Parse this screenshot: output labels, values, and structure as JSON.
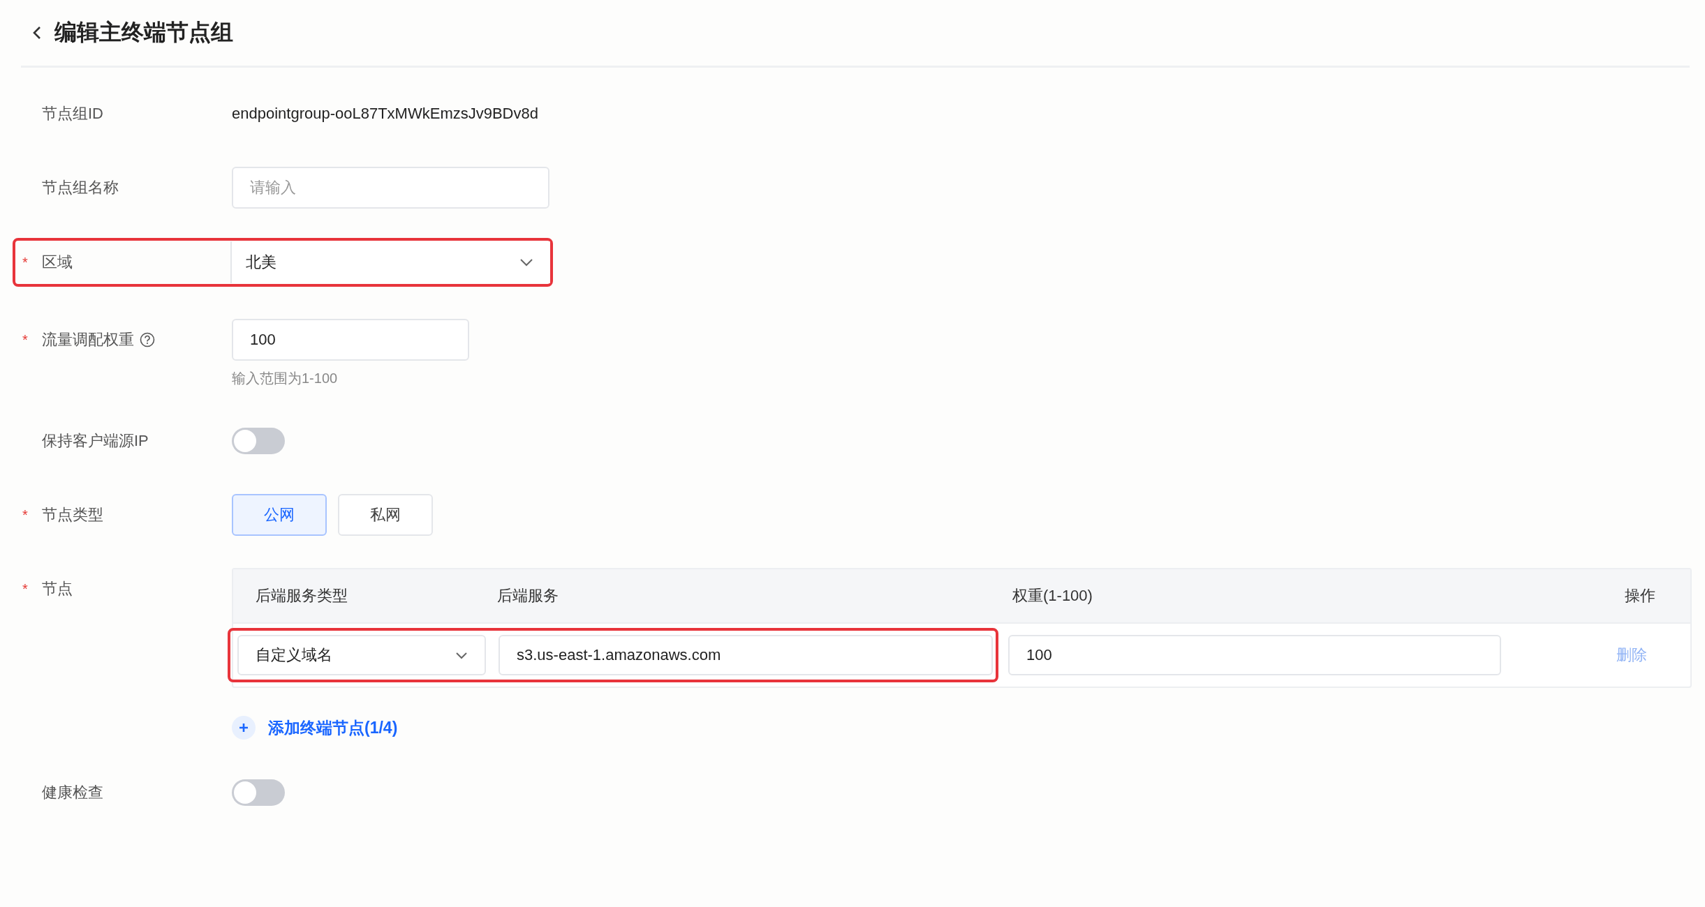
{
  "header": {
    "title": "编辑主终端节点组"
  },
  "fields": [
    {
      "kind": "text",
      "label": "节点组ID",
      "value": "endpointgroup-ooL87TxMWkEmzsJv9BDv8d"
    },
    {
      "kind": "input",
      "label": "节点组名称",
      "placeholder": "请输入"
    },
    {
      "kind": "select",
      "required_mark": "*",
      "label": "区域",
      "value": "北美",
      "highlighted": true
    },
    {
      "kind": "number",
      "required_mark": "*",
      "label": "流量调配权重",
      "help": true,
      "value": "100",
      "hint": "输入范围为1-100"
    },
    {
      "kind": "switch",
      "label": "保持客户端源IP",
      "on": false
    },
    {
      "kind": "segmented",
      "required_mark": "*",
      "label": "节点类型",
      "options": [
        {
          "label": "公网",
          "selected": true
        },
        {
          "label": "私网",
          "selected": false
        }
      ]
    },
    {
      "kind": "nodes",
      "required_mark": "*",
      "label": "节点",
      "columns": [
        "后端服务类型",
        "后端服务",
        "权重(1-100)",
        "操作"
      ],
      "rows": [
        {
          "type": "自定义域名",
          "service": "s3.us-east-1.amazonaws.com",
          "weight": "100",
          "action": "删除",
          "highlighted": true
        }
      ],
      "add_label": "添加终端节点(1/4)"
    },
    {
      "kind": "switch",
      "label": "健康检查",
      "on": false
    }
  ]
}
